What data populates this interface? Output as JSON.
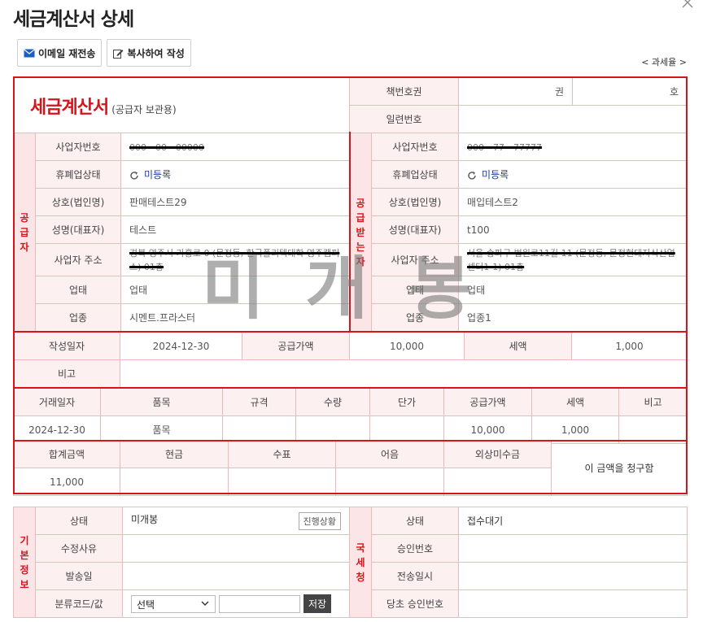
{
  "page_title": "세금계산서 상세",
  "toolbar": {
    "email_label": "이메일 재전송",
    "copy_label": "복사하여 작성"
  },
  "tax_link": "< 과세율 >",
  "invoice": {
    "title": "세금계산서",
    "subtitle": "(공급자 보관용)",
    "book_no_label": "책번호권",
    "book_unit_1": "권",
    "book_unit_2": "호",
    "serial_label": "일련번호"
  },
  "supplier": {
    "side_label": "공급자",
    "labels": [
      "사업자번호",
      "휴폐업상태",
      "상호(법인명)",
      "성명(대표자)",
      "사업자 주소",
      "업태",
      "업종"
    ],
    "biz_no": "000 - 00 - 00000",
    "status": "미등록",
    "name": "판매테스트29",
    "ceo": "테스트",
    "address": "경북 영주시 가흥로 0 (문정동, 한국폴리텍대학 영주캠퍼스) 01층",
    "biz_type": "업태",
    "biz_item": "시멘트.프라스터"
  },
  "buyer": {
    "side_label": "공급받는자",
    "labels": [
      "사업자번호",
      "휴폐업상태",
      "상호(법인명)",
      "성명(대표자)",
      "사업자 주소",
      "업태",
      "업종"
    ],
    "biz_no": "000 - 77 - 77777",
    "status": "미등록",
    "name": "매입테스트2",
    "ceo": "t100",
    "address": "서울 송파구 법원로11길 11 (문정동, 문정현대지식산업센터1-1) 01층",
    "biz_type": "업태",
    "biz_item": "업종1"
  },
  "summary": {
    "date_label": "작성일자",
    "date": "2024-12-30",
    "supply_label": "공급가액",
    "supply": "10,000",
    "tax_label": "세액",
    "tax": "1,000",
    "note_label": "비고",
    "note": ""
  },
  "items": {
    "headers": [
      "거래일자",
      "품목",
      "규격",
      "수량",
      "단가",
      "공급가액",
      "세액",
      "비고"
    ],
    "rows": [
      [
        "2024-12-30",
        "품목",
        "",
        "",
        "",
        "10,000",
        "1,000",
        ""
      ]
    ]
  },
  "totals": {
    "headers": [
      "합계금액",
      "현금",
      "수표",
      "어음",
      "외상미수금"
    ],
    "values": [
      "11,000",
      "",
      "",
      "",
      ""
    ],
    "claim": "이 금액을 청구함"
  },
  "stamp": "미개봉",
  "basic": {
    "side_label": "기본정보",
    "status_label": "상태",
    "status": "미개봉",
    "progress_btn": "진행상황",
    "reason_label": "수정사유",
    "send_label": "발송일",
    "class_label": "분류코드/값",
    "select_value": "선택",
    "save_label": "저장"
  },
  "nts": {
    "side_label": "국세청",
    "status_label": "상태",
    "status": "접수대기",
    "approval_label": "승인번호",
    "sent_label": "전송일시",
    "orig_label": "당초 승인번호"
  }
}
